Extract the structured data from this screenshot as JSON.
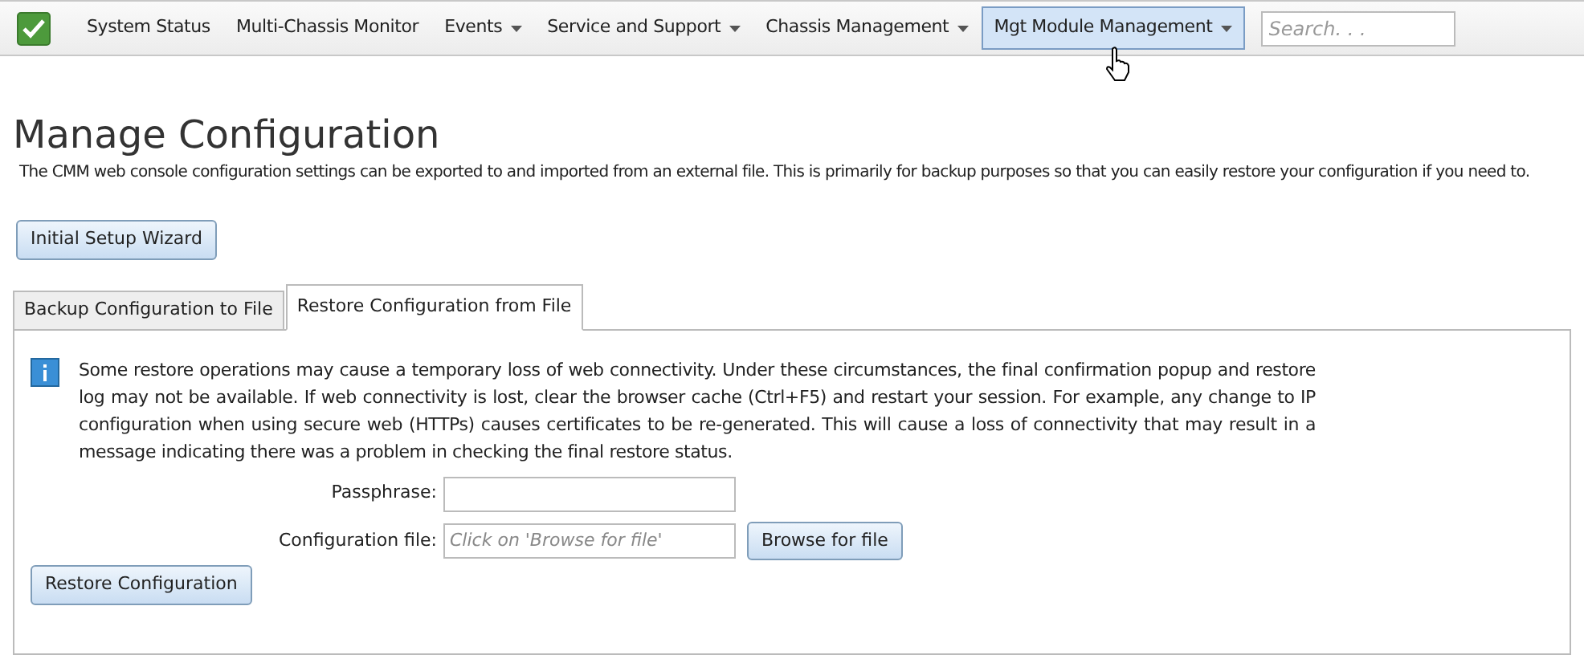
{
  "nav": {
    "items": [
      {
        "label": "System Status",
        "dropdown": false,
        "selected": false
      },
      {
        "label": "Multi-Chassis Monitor",
        "dropdown": false,
        "selected": false
      },
      {
        "label": "Events",
        "dropdown": true,
        "selected": false
      },
      {
        "label": "Service and Support",
        "dropdown": true,
        "selected": false
      },
      {
        "label": "Chassis Management",
        "dropdown": true,
        "selected": false
      },
      {
        "label": "Mgt Module Management",
        "dropdown": true,
        "selected": true
      }
    ],
    "search": {
      "placeholder": "Search. . ."
    }
  },
  "page": {
    "title": "Manage Configuration",
    "description": "The CMM web console configuration settings can be exported to and imported from an external file. This is primarily for backup purposes so that you can easily restore your configuration if you need to.",
    "wizard_button": "Initial Setup Wizard"
  },
  "tabs": [
    {
      "label": "Backup Configuration to File",
      "selected": false
    },
    {
      "label": "Restore Configuration from File",
      "selected": true
    }
  ],
  "restore": {
    "notice": "Some restore operations may cause a temporary loss of web connectivity. Under these circumstances, the final confirmation popup and restore log may not be available. If web connectivity is lost, clear the browser cache (Ctrl+F5) and restart your session. For example, any change to IP configuration when using secure web (HTTPs) causes certificates to be re-generated. This will cause a loss of connectivity that may result in a message indicating there was a problem in checking the final restore status.",
    "passphrase_label": "Passphrase:",
    "file_label": "Configuration file:",
    "file_placeholder": "Click on 'Browse for file'",
    "browse_button": "Browse for file",
    "restore_button": "Restore Configuration"
  }
}
